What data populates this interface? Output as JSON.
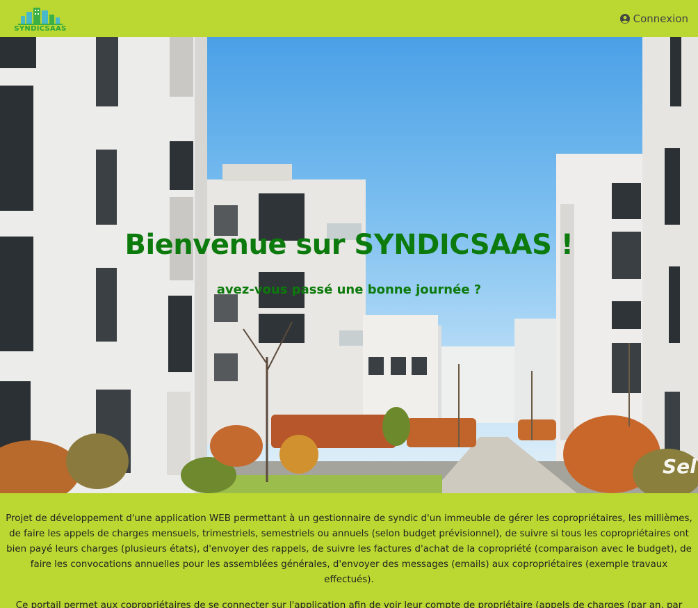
{
  "brand": {
    "logo_text": "SYNDICSAAS"
  },
  "nav": {
    "login_label": "Connexion",
    "login_icon": "user-circle-icon"
  },
  "hero": {
    "title": "Bienvenue sur SYNDICSAAS !",
    "subtitle": "avez-vous passé une bonne journée ?",
    "watermark": "Sel"
  },
  "intro": {
    "paragraph_1": "Projet de développement d'une application WEB permettant à un gestionnaire de syndic d'un immeuble de gérer les copropriétaires, les millièmes, de faire les appels de charges mensuels, trimestriels, semestriels ou annuels (selon budget prévisionnel), de suivre si tous les copropriétaires ont bien payé leurs charges (plusieurs états), d'envoyer des rappels, de suivre les factures d'achat de la copropriété (comparaison avec le budget), de faire les convocations annuelles pour les assemblées générales, d'envoyer des messages (emails) aux copropriétaires (exemple travaux effectués).",
    "paragraph_2": "Ce portail permet aux copropriétaires de se connecter sur l'application afin de voir leur compte de propriétaire (appels de charges (par an, par mois),"
  },
  "colors": {
    "accent": "#bbd731",
    "title_green": "#0c7a0c",
    "logo_green": "#2aa63c"
  }
}
